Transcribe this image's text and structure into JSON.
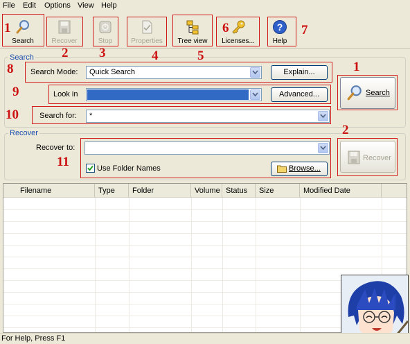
{
  "menu": [
    "File",
    "Edit",
    "Options",
    "View",
    "Help"
  ],
  "toolbar": {
    "search": "Search",
    "recover": "Recover",
    "stop": "Stop",
    "properties": "Properties",
    "tree_view": "Tree view",
    "licenses": "Licenses...",
    "help": "Help"
  },
  "annotations": [
    "1",
    "2",
    "3",
    "4",
    "5",
    "6",
    "7",
    "8",
    "9",
    "10",
    "11",
    "1",
    "2"
  ],
  "search_group": {
    "title": "Search",
    "mode_label": "Search Mode:",
    "mode_value": "Quick Search",
    "explain_button": "Explain...",
    "lookin_label": "Look in",
    "lookin_value": "",
    "advanced_button": "Advanced...",
    "searchfor_label": "Search for:",
    "searchfor_value": "*",
    "search_button": "Search"
  },
  "recover_group": {
    "title": "Recover",
    "recoverto_label": "Recover to:",
    "recoverto_value": "",
    "use_folder_names": "Use Folder Names",
    "use_folder_names_checked": true,
    "browse_button": "Browse...",
    "recover_button": "Recover"
  },
  "table": {
    "columns": [
      "Filename",
      "Type",
      "Folder",
      "Volume",
      "Status",
      "Size",
      "Modified Date"
    ]
  },
  "status_text": "For Help, Press F1",
  "colors": {
    "annotation_red": "#cc1111",
    "group_title_blue": "#1c4fae",
    "lookin_highlight": "#316ac5"
  }
}
